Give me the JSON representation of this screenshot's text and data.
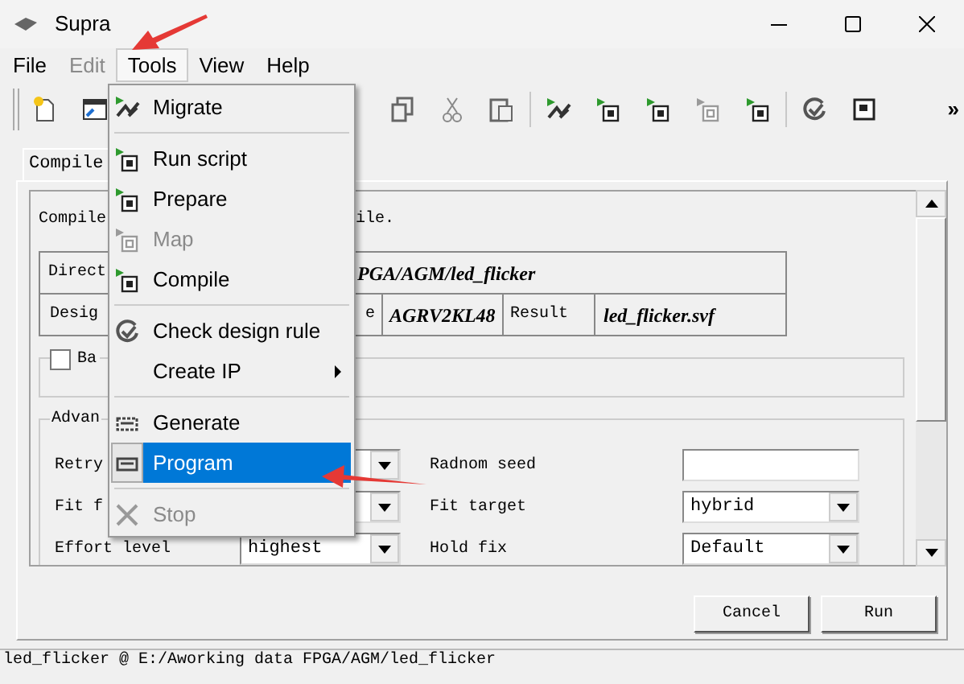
{
  "window": {
    "title": "Supra"
  },
  "menu_bar": [
    {
      "label": "File",
      "disabled": false,
      "selected": false
    },
    {
      "label": "Edit",
      "disabled": true,
      "selected": false
    },
    {
      "label": "Tools",
      "disabled": false,
      "selected": true
    },
    {
      "label": "View",
      "disabled": false,
      "selected": false
    },
    {
      "label": "Help",
      "disabled": false,
      "selected": false
    }
  ],
  "toolbar_overflow": "»",
  "tabs": [
    {
      "label": "Compile",
      "selected": true
    }
  ],
  "description": {
    "left": "Compile",
    "right": "ile."
  },
  "design_table": {
    "rows": [
      [
        "Direct",
        "PGA/AGM/led_flicker"
      ],
      [
        "Desig",
        "e",
        "AGRV2KL48",
        "Result",
        "led_flicker.svf"
      ]
    ]
  },
  "option_group": {
    "label": "Ba",
    "checked": false
  },
  "advanced": {
    "title": "Advan",
    "left": [
      {
        "label": "Retry",
        "kind": "select"
      },
      {
        "label": "Fit f",
        "kind": "select"
      },
      {
        "label": "Effort level",
        "kind": "select",
        "value": "highest"
      }
    ],
    "right": [
      {
        "label": "Radnom seed",
        "kind": "text"
      },
      {
        "label": "Fit target",
        "kind": "select",
        "value": "hybrid"
      },
      {
        "label": "Hold fix",
        "kind": "select",
        "value": "Default"
      }
    ]
  },
  "buttons": [
    "Cancel",
    "Run"
  ],
  "tools_menu": [
    {
      "kind": "item",
      "label": "Migrate",
      "disabled": false,
      "selected": false,
      "submenu": false
    },
    {
      "kind": "separator"
    },
    {
      "kind": "item",
      "label": "Run script",
      "disabled": false,
      "selected": false,
      "submenu": false
    },
    {
      "kind": "item",
      "label": "Prepare",
      "disabled": false,
      "selected": false,
      "submenu": false
    },
    {
      "kind": "item",
      "label": "Map",
      "disabled": true,
      "selected": false,
      "submenu": false
    },
    {
      "kind": "item",
      "label": "Compile",
      "disabled": false,
      "selected": false,
      "submenu": false
    },
    {
      "kind": "separator"
    },
    {
      "kind": "item",
      "label": "Check design rule",
      "disabled": false,
      "selected": false,
      "submenu": false
    },
    {
      "kind": "item",
      "label": "Create IP",
      "disabled": false,
      "selected": false,
      "submenu": true
    },
    {
      "kind": "separator"
    },
    {
      "kind": "item",
      "label": "Generate",
      "disabled": false,
      "selected": false,
      "submenu": false
    },
    {
      "kind": "item",
      "label": "Program",
      "disabled": false,
      "selected": true,
      "submenu": false
    },
    {
      "kind": "separator"
    },
    {
      "kind": "item",
      "label": "Stop",
      "disabled": true,
      "selected": false,
      "submenu": false
    }
  ],
  "status_bar": "led_flicker @ E:/Aworking data FPGA/AGM/led_flicker"
}
